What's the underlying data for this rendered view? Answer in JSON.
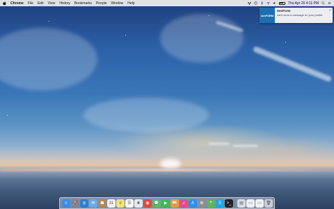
{
  "menubar": {
    "app_name": "Chrome",
    "items": [
      "File",
      "Edit",
      "View",
      "History",
      "Bookmarks",
      "People",
      "Window",
      "Help"
    ],
    "clock": "Thu Apr 26  4:11 PM"
  },
  "notification": {
    "logo_text": "senFORM",
    "title": "SenForm",
    "message": "can't send a message on your profile.",
    "close_glyph": "✕",
    "expand_glyph": "⌄"
  },
  "dock": {
    "apps": [
      {
        "name": "finder",
        "color": "#3a8ee6",
        "glyph": "☺"
      },
      {
        "name": "launchpad",
        "color": "#7b8794",
        "glyph": "🚀"
      },
      {
        "name": "safari",
        "color": "#2b7fd4",
        "glyph": "◎"
      },
      {
        "name": "mail",
        "color": "#6aa9e8",
        "glyph": "✉"
      },
      {
        "name": "contacts",
        "color": "#b08a5a",
        "glyph": "☗"
      },
      {
        "name": "calendar",
        "color": "#f4f4f4",
        "glyph": "31"
      },
      {
        "name": "notes",
        "color": "#f2e27a",
        "glyph": "≡"
      },
      {
        "name": "reminders",
        "color": "#f8f8f8",
        "glyph": "☰"
      },
      {
        "name": "photos",
        "color": "#e9e9e9",
        "glyph": "❀"
      },
      {
        "name": "chrome",
        "color": "#e0493e",
        "glyph": "◉"
      },
      {
        "name": "messages",
        "color": "#53c25c",
        "glyph": "💬"
      },
      {
        "name": "facetime",
        "color": "#3dbb4f",
        "glyph": "▶"
      },
      {
        "name": "ibooks",
        "color": "#f39a2b",
        "glyph": "📖"
      },
      {
        "name": "itunes",
        "color": "#e64b8a",
        "glyph": "♫"
      },
      {
        "name": "app-store",
        "color": "#2f8fe8",
        "glyph": "A"
      },
      {
        "name": "system-preferences",
        "color": "#8a8f96",
        "glyph": "⚙"
      },
      {
        "name": "maps",
        "color": "#5fb25f",
        "glyph": "⌖"
      },
      {
        "name": "skype",
        "color": "#1fa5e8",
        "glyph": "S"
      },
      {
        "name": "terminal",
        "color": "#222222",
        "glyph": ">_"
      }
    ],
    "right_items": [
      {
        "name": "documents-stack",
        "color": "#d9dde3",
        "glyph": "▤"
      },
      {
        "name": "downloads-stack",
        "color": "#eef0f3",
        "glyph": "▭"
      },
      {
        "name": "folder-stack",
        "color": "#f0f1f4",
        "glyph": "▭"
      },
      {
        "name": "trash",
        "color": "#c9ced6",
        "glyph": "🗑"
      }
    ]
  }
}
